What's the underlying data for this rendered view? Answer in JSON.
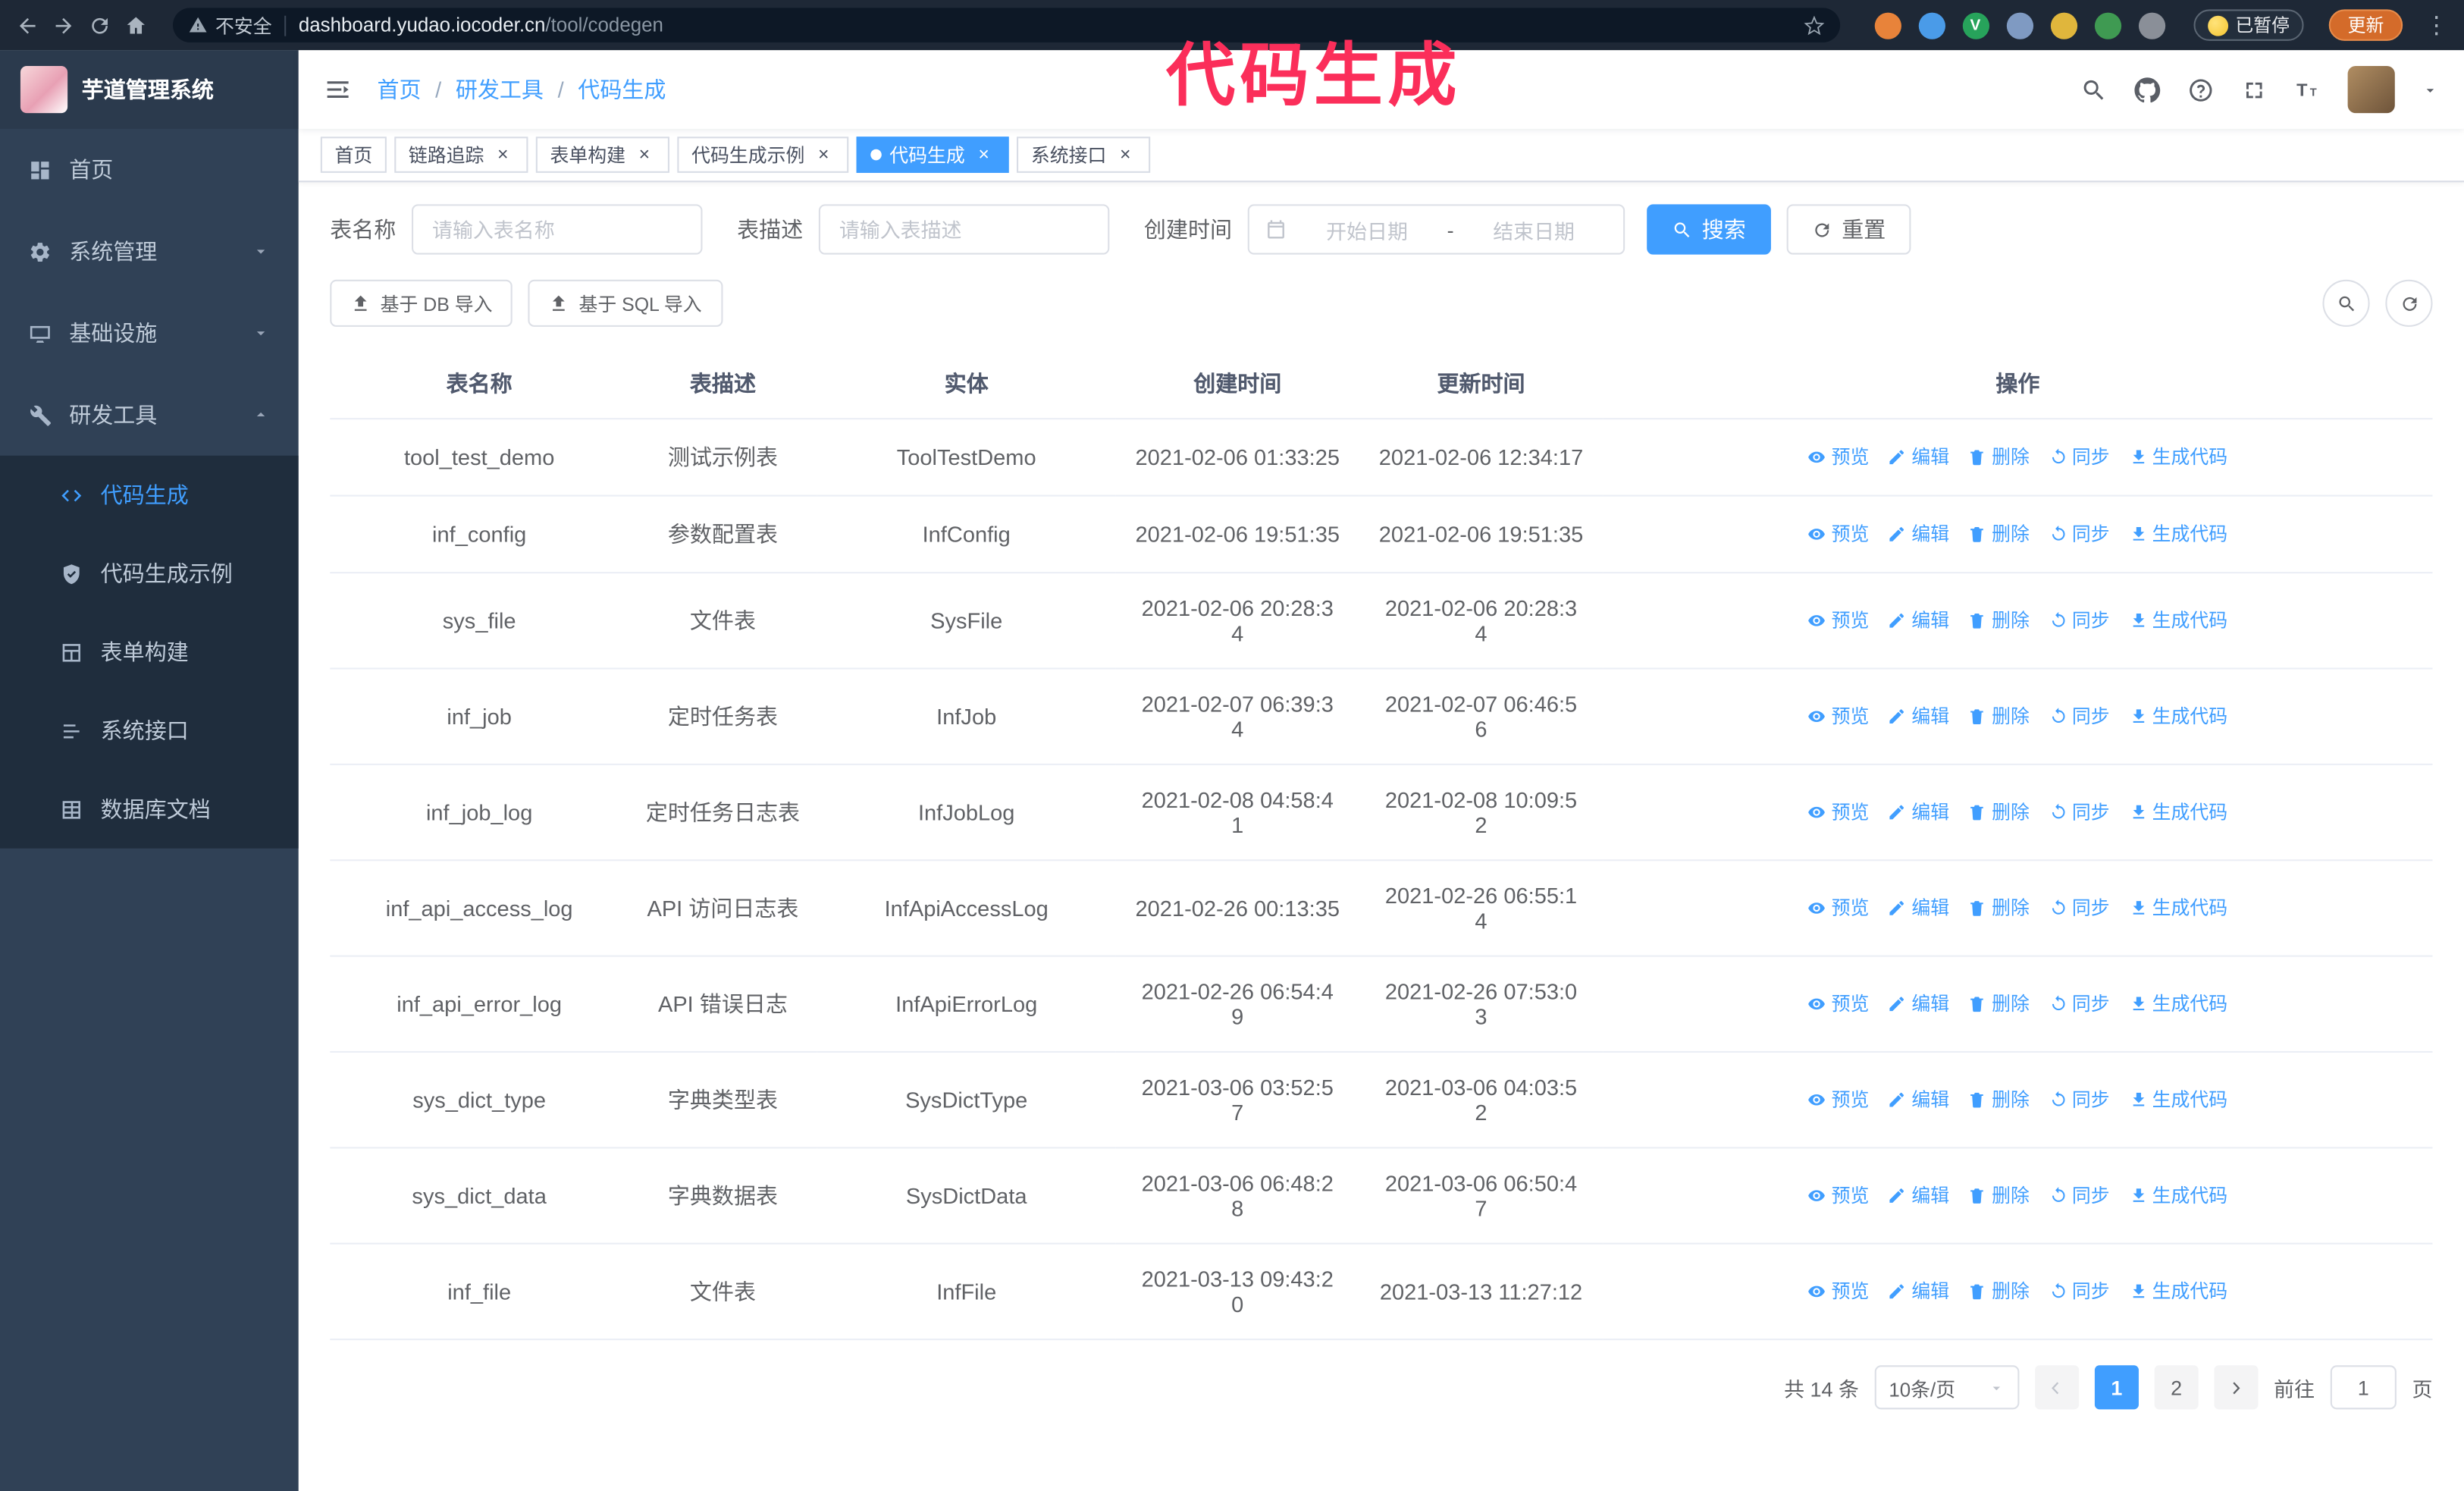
{
  "colors": {
    "accent": "#409EFF",
    "annotation": "#fb2e5a",
    "sidebar_bg": "#304156",
    "submenu_bg": "#1f2d3d",
    "chrome_bg": "#1e2836",
    "update_button_bg": "#d46b2a"
  },
  "browser": {
    "security_label": "不安全",
    "url_host": "dashboard.yudao.iocoder.cn",
    "url_path": "/tool/codegen",
    "paused_badge": "已暂停",
    "update_button": "更新"
  },
  "annotation": {
    "text": "代码生成"
  },
  "sidebar": {
    "logo_title": "芋道管理系统",
    "items": [
      {
        "label": "首页",
        "icon": "dashboard"
      },
      {
        "label": "系统管理",
        "icon": "gear"
      },
      {
        "label": "基础设施",
        "icon": "monitor"
      },
      {
        "label": "研发工具",
        "icon": "tool"
      }
    ],
    "subitems": [
      {
        "label": "代码生成",
        "icon": "code",
        "active": true
      },
      {
        "label": "代码生成示例",
        "icon": "shield"
      },
      {
        "label": "表单构建",
        "icon": "form"
      },
      {
        "label": "系统接口",
        "icon": "api"
      },
      {
        "label": "数据库文档",
        "icon": "database"
      }
    ]
  },
  "header": {
    "breadcrumb": [
      "首页",
      "研发工具",
      "代码生成"
    ],
    "separator": "/"
  },
  "tabs": [
    {
      "label": "首页",
      "closable": false
    },
    {
      "label": "链路追踪",
      "closable": true
    },
    {
      "label": "表单构建",
      "closable": true
    },
    {
      "label": "代码生成示例",
      "closable": true
    },
    {
      "label": "代码生成",
      "closable": true,
      "active": true
    },
    {
      "label": "系统接口",
      "closable": true
    }
  ],
  "filters": {
    "table_name_label": "表名称",
    "table_name_placeholder": "请输入表名称",
    "table_desc_label": "表描述",
    "table_desc_placeholder": "请输入表描述",
    "create_time_label": "创建时间",
    "date_start_placeholder": "开始日期",
    "date_separator": "-",
    "date_end_placeholder": "结束日期",
    "search_button": "搜索",
    "reset_button": "重置"
  },
  "toolbar": {
    "import_db_button": "基于 DB 导入",
    "import_sql_button": "基于 SQL 导入"
  },
  "table": {
    "columns": [
      "表名称",
      "表描述",
      "实体",
      "创建时间",
      "更新时间",
      "操作"
    ],
    "actions": [
      "预览",
      "编辑",
      "删除",
      "同步",
      "生成代码"
    ],
    "rows": [
      {
        "name": "tool_test_demo",
        "desc": "测试示例表",
        "entity": "ToolTestDemo",
        "created": "2021-02-06 01:33:25",
        "updated": "2021-02-06 12:34:17"
      },
      {
        "name": "inf_config",
        "desc": "参数配置表",
        "entity": "InfConfig",
        "created": "2021-02-06 19:51:35",
        "updated": "2021-02-06 19:51:35"
      },
      {
        "name": "sys_file",
        "desc": "文件表",
        "entity": "SysFile",
        "created": "2021-02-06 20:28:3\n4",
        "updated": "2021-02-06 20:28:3\n4"
      },
      {
        "name": "inf_job",
        "desc": "定时任务表",
        "entity": "InfJob",
        "created": "2021-02-07 06:39:3\n4",
        "updated": "2021-02-07 06:46:5\n6"
      },
      {
        "name": "inf_job_log",
        "desc": "定时任务日志表",
        "entity": "InfJobLog",
        "created": "2021-02-08 04:58:4\n1",
        "updated": "2021-02-08 10:09:5\n2"
      },
      {
        "name": "inf_api_access_log",
        "desc": "API 访问日志表",
        "entity": "InfApiAccessLog",
        "created": "2021-02-26 00:13:35",
        "updated": "2021-02-26 06:55:1\n4"
      },
      {
        "name": "inf_api_error_log",
        "desc": "API 错误日志",
        "entity": "InfApiErrorLog",
        "created": "2021-02-26 06:54:4\n9",
        "updated": "2021-02-26 07:53:0\n3"
      },
      {
        "name": "sys_dict_type",
        "desc": "字典类型表",
        "entity": "SysDictType",
        "created": "2021-03-06 03:52:5\n7",
        "updated": "2021-03-06 04:03:5\n2"
      },
      {
        "name": "sys_dict_data",
        "desc": "字典数据表",
        "entity": "SysDictData",
        "created": "2021-03-06 06:48:2\n8",
        "updated": "2021-03-06 06:50:4\n7"
      },
      {
        "name": "inf_file",
        "desc": "文件表",
        "entity": "InfFile",
        "created": "2021-03-13 09:43:2\n0",
        "updated": "2021-03-13 11:27:12"
      }
    ]
  },
  "pagination": {
    "total_text": "共 14 条",
    "page_size": "10条/页",
    "pages": [
      "1",
      "2"
    ],
    "active_page": "1",
    "goto_label": "前往",
    "goto_value": "1",
    "goto_suffix": "页"
  }
}
